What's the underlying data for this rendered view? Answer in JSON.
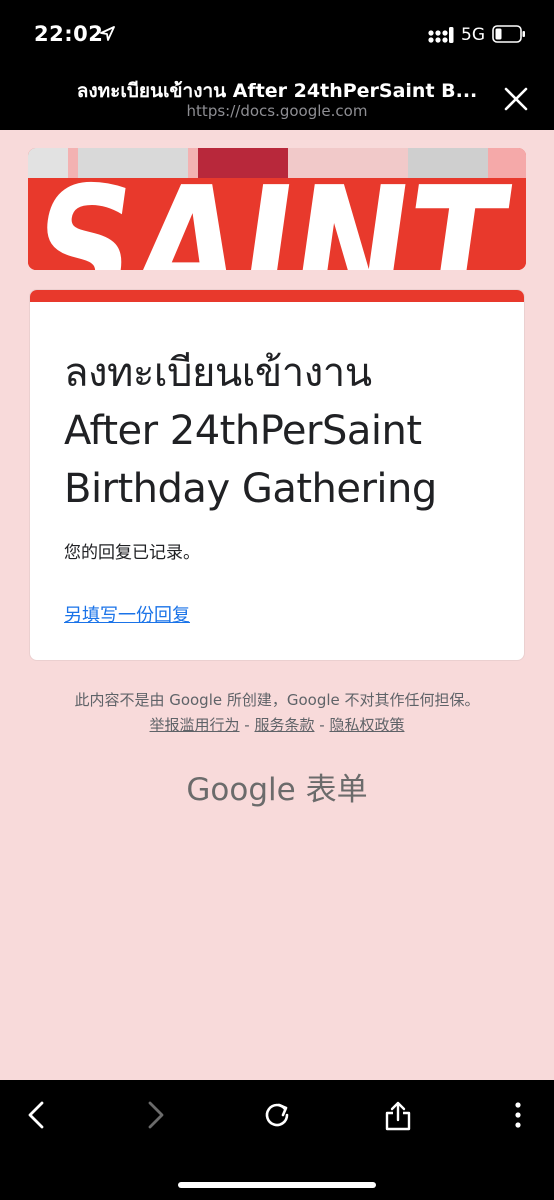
{
  "status_bar": {
    "time": "22:02",
    "network": "5G",
    "icons": [
      "location-arrow-icon",
      "signal-icon",
      "battery-icon"
    ]
  },
  "browser": {
    "title": "ลงทะเบียนเข้างาน After 24thPerSaint B...",
    "url": "https://docs.google.com",
    "close_icon": "close-icon"
  },
  "banner": {
    "text": "SAINT",
    "colors": {
      "background": "#e8392c",
      "text": "#ffffff"
    }
  },
  "form": {
    "title_lines": [
      "ลงทะเบียนเข้างาน",
      "After 24thPerSaint",
      "Birthday Gathering"
    ],
    "confirmation": "您的回复已记录。",
    "submit_another": "另填写一份回复",
    "accent_color": "#e8392c"
  },
  "footer": {
    "disclaimer": "此内容不是由 Google 所创建，Google 不对其作任何担保。",
    "links": [
      "举报滥用行为",
      "服务条款",
      "隐私权政策"
    ],
    "separator": " - ",
    "brand_google": "Google",
    "brand_forms": "表单"
  },
  "toolbar": {
    "icons": [
      "back-icon",
      "forward-icon",
      "reload-icon",
      "share-icon",
      "more-icon"
    ]
  },
  "colors": {
    "page_background": "#f8dada",
    "link": "#1a73e8"
  }
}
